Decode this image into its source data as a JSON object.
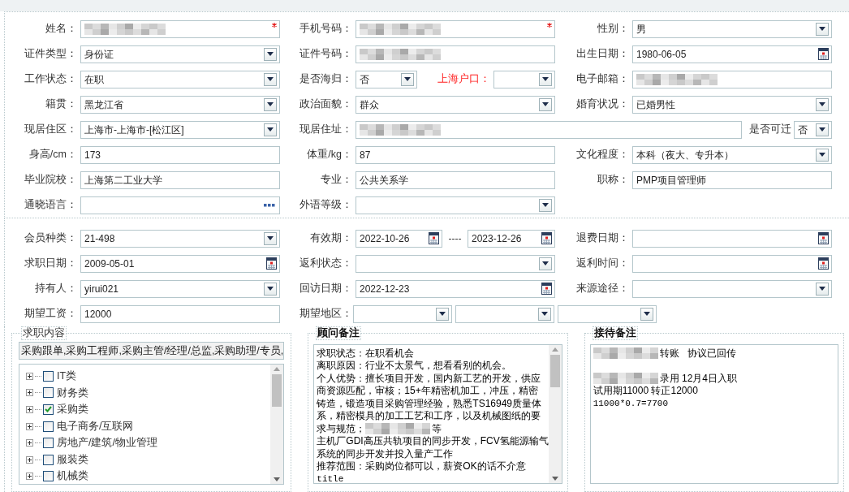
{
  "sections": [
    {
      "rows": [
        {
          "cells": [
            {
              "kind": "single",
              "label": "姓名：",
              "control": {
                "kind": "redacted",
                "required": true
              }
            },
            {
              "kind": "single",
              "label": "手机号码：",
              "control": {
                "kind": "redacted",
                "required": true
              }
            },
            {
              "kind": "single",
              "label": "性别：",
              "control": {
                "kind": "select",
                "value": "男"
              }
            }
          ]
        },
        {
          "cells": [
            {
              "kind": "single",
              "label": "证件类型：",
              "control": {
                "kind": "select",
                "value": "身份证"
              }
            },
            {
              "kind": "single",
              "label": "证件号码：",
              "control": {
                "kind": "redacted"
              }
            },
            {
              "kind": "single",
              "label": "出生日期：",
              "control": {
                "kind": "date",
                "value": "1980-06-05"
              }
            }
          ]
        },
        {
          "cells": [
            {
              "kind": "single",
              "label": "工作状态：",
              "control": {
                "kind": "select",
                "value": "在职"
              }
            },
            {
              "kind": "pair",
              "label": "是否海归：",
              "control": {
                "kind": "select",
                "value": "否"
              },
              "second": {
                "label": "上海户口：",
                "emphasis": true,
                "control": {
                  "kind": "select"
                }
              }
            },
            {
              "kind": "single",
              "label": "电子邮箱：",
              "control": {
                "kind": "redacted"
              }
            }
          ]
        },
        {
          "cells": [
            {
              "kind": "single",
              "label": "籍贯：",
              "control": {
                "kind": "select",
                "value": "黑龙江省"
              }
            },
            {
              "kind": "single",
              "label": "政治面貌：",
              "control": {
                "kind": "select",
                "value": "群众"
              }
            },
            {
              "kind": "single",
              "label": "婚育状况：",
              "control": {
                "kind": "select",
                "value": "已婚男性"
              }
            }
          ]
        },
        {
          "cells": [
            {
              "kind": "single",
              "label": "现居住区：",
              "control": {
                "kind": "select",
                "value": "上海市-上海市-[松江区]"
              }
            },
            {
              "kind": "address",
              "label": "现居住址：",
              "control": {
                "kind": "redacted"
              },
              "second": {
                "label": "是否可迁",
                "emphasis": false,
                "control": {
                  "kind": "select",
                  "value": "否"
                }
              }
            }
          ]
        },
        {
          "cells": [
            {
              "kind": "single",
              "label": "身高/cm：",
              "control": {
                "kind": "text",
                "value": "173"
              }
            },
            {
              "kind": "single",
              "label": "体重/kg：",
              "control": {
                "kind": "text",
                "value": "87"
              }
            },
            {
              "kind": "single",
              "label": "文化程度：",
              "control": {
                "kind": "select",
                "value": "本科（夜大、专升本）"
              }
            }
          ]
        },
        {
          "cells": [
            {
              "kind": "single",
              "label": "毕业院校：",
              "control": {
                "kind": "text",
                "value": "上海第二工业大学"
              }
            },
            {
              "kind": "single",
              "label": "专业：",
              "control": {
                "kind": "text",
                "value": "公共关系学"
              }
            },
            {
              "kind": "single",
              "label": "职称：",
              "control": {
                "kind": "text",
                "value": "PMP项目管理师"
              }
            }
          ]
        },
        {
          "cells": [
            {
              "kind": "single",
              "label": "通晓语言：",
              "control": {
                "kind": "lookup"
              }
            },
            {
              "kind": "single",
              "label": "外语等级：",
              "control": {
                "kind": "select"
              }
            }
          ]
        }
      ]
    },
    {
      "rows": [
        {
          "cells": [
            {
              "kind": "single",
              "label": "会员种类：",
              "control": {
                "kind": "select",
                "value": "21-498"
              }
            },
            {
              "kind": "range",
              "label": "有效期：",
              "controls": [
                {
                  "kind": "date",
                  "value": "2022-10-26"
                },
                {
                  "kind": "date",
                  "value": "2023-12-26"
                }
              ],
              "separator": "----"
            },
            {
              "kind": "single",
              "label": "退费日期：",
              "control": {
                "kind": "date"
              }
            }
          ]
        },
        {
          "cells": [
            {
              "kind": "single",
              "label": "求职日期：",
              "control": {
                "kind": "date",
                "value": "2009-05-01"
              }
            },
            {
              "kind": "single",
              "label": "返利状态：",
              "control": {
                "kind": "select"
              }
            },
            {
              "kind": "single",
              "label": "返利时间：",
              "control": {
                "kind": "date"
              }
            }
          ]
        },
        {
          "cells": [
            {
              "kind": "single",
              "label": "持有人：",
              "control": {
                "kind": "select",
                "value": "yirui021"
              }
            },
            {
              "kind": "single",
              "label": "回访日期：",
              "control": {
                "kind": "date",
                "value": "2022-12-23"
              }
            },
            {
              "kind": "single",
              "label": "来源途径：",
              "control": {
                "kind": "select"
              }
            }
          ]
        },
        {
          "cells": [
            {
              "kind": "single",
              "label": "期望工资：",
              "control": {
                "kind": "text",
                "value": "12000"
              }
            },
            {
              "kind": "multi",
              "label": "期望地区：",
              "controls": [
                {
                  "kind": "select"
                },
                {
                  "kind": "select"
                },
                {
                  "kind": "select"
                }
              ]
            }
          ]
        }
      ]
    }
  ],
  "panels": [
    {
      "kind": "tree",
      "legend": "求职内容",
      "summary": "采购跟单,采购工程师,采购主管/经理/总监,采购助理/专员,",
      "items": [
        {
          "label": "IT类",
          "checked": false,
          "expanded": false
        },
        {
          "label": "财务类",
          "checked": false,
          "expanded": false
        },
        {
          "label": "采购类",
          "checked": true,
          "expanded": false
        },
        {
          "label": "电子商务/互联网",
          "checked": false,
          "expanded": false
        },
        {
          "label": "房地产/建筑/物业管理",
          "checked": false,
          "expanded": false
        },
        {
          "label": "服装类",
          "checked": false,
          "expanded": false
        },
        {
          "label": "机械类",
          "checked": false,
          "expanded": false
        }
      ]
    },
    {
      "kind": "notes",
      "legend": "顾问备注",
      "scroll": true,
      "lines": [
        {
          "kind": "text",
          "segments": [
            {
              "kind": "text",
              "text": "求职状态：在职看机会"
            }
          ]
        },
        {
          "kind": "text",
          "segments": [
            {
              "kind": "text",
              "text": "离职原因：行业不太景气，想看看别的机会。"
            }
          ]
        },
        {
          "kind": "text",
          "segments": [
            {
              "kind": "text",
              "text": "个人优势：擅长项目开发，国内新工艺的开发，供应"
            }
          ]
        },
        {
          "kind": "text",
          "segments": [
            {
              "kind": "text",
              "text": "商资源匹配，审核；15+年精密机加工，冲压，精密"
            }
          ]
        },
        {
          "kind": "text",
          "segments": [
            {
              "kind": "text",
              "text": "铸造，锻造项目采购管理经验，熟悉TS16949质量体"
            }
          ]
        },
        {
          "kind": "text",
          "segments": [
            {
              "kind": "text",
              "text": "系，精密模具的加工工艺和工序，以及机械图纸的要"
            }
          ]
        },
        {
          "kind": "text",
          "segments": [
            {
              "kind": "text",
              "text": "求与规范；"
            },
            {
              "kind": "redacted"
            },
            {
              "kind": "text",
              "text": "等"
            }
          ]
        },
        {
          "kind": "text",
          "segments": [
            {
              "kind": "text",
              "text": "主机厂GDI高压共轨项目的同步开发，FCV氢能源输气"
            }
          ]
        },
        {
          "kind": "text",
          "segments": [
            {
              "kind": "text",
              "text": "系统的同步开发并投入量产工作"
            }
          ]
        },
        {
          "kind": "text",
          "segments": [
            {
              "kind": "text",
              "text": "推荐范围：采购岗位都可以，薪资OK的话不介意"
            }
          ]
        },
        {
          "kind": "text",
          "segments": [
            {
              "kind": "mono",
              "text": "title"
            }
          ]
        }
      ]
    },
    {
      "kind": "notes",
      "legend": "接待备注",
      "scroll": false,
      "lines": [
        {
          "kind": "text",
          "segments": [
            {
              "kind": "redacted"
            },
            {
              "kind": "text",
              "text": "转账   协议已回传"
            }
          ]
        },
        {
          "kind": "blank"
        },
        {
          "kind": "text",
          "segments": [
            {
              "kind": "redacted"
            },
            {
              "kind": "text",
              "text": "录用 12月4日入职"
            }
          ]
        },
        {
          "kind": "text",
          "segments": [
            {
              "kind": "text",
              "text": "试用期11000 转正12000"
            }
          ]
        },
        {
          "kind": "text",
          "segments": [
            {
              "kind": "mono",
              "text": "11000*0.7=7700"
            }
          ]
        }
      ]
    }
  ]
}
